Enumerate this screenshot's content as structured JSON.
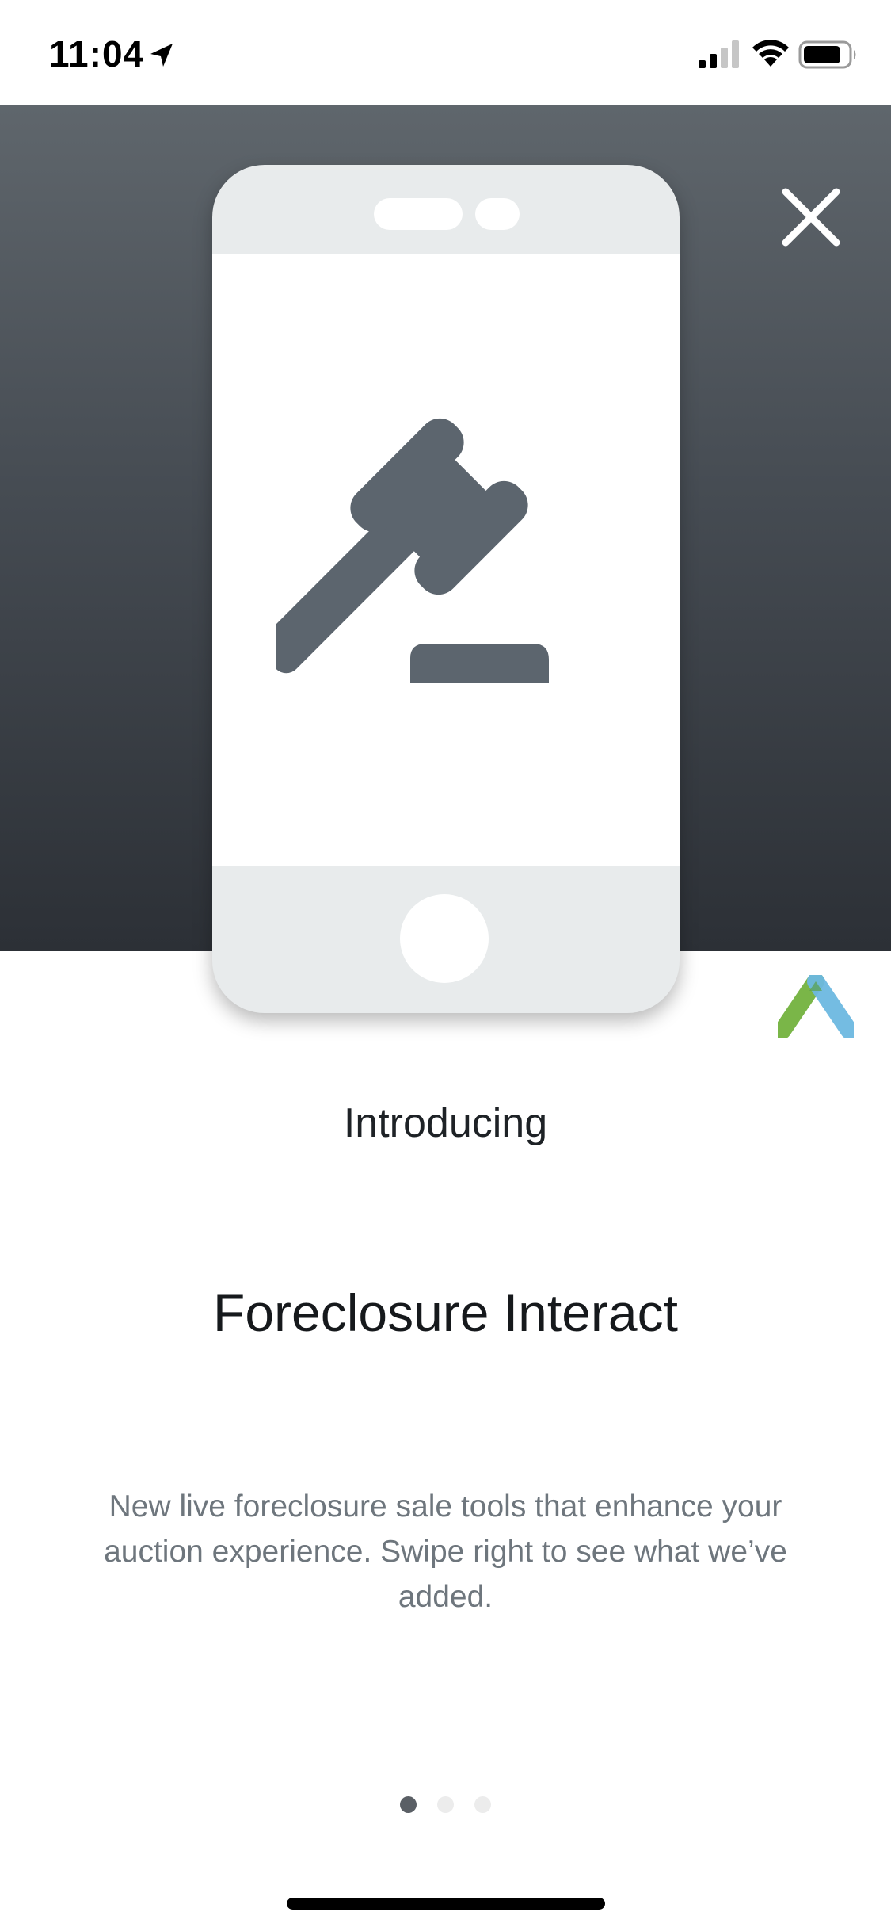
{
  "status_bar": {
    "time": "11:04",
    "icons": [
      "location-arrow-icon",
      "cellular-signal-icon",
      "wifi-icon",
      "battery-icon"
    ]
  },
  "hero": {
    "background_colors": [
      "#5f666c",
      "#2c3036"
    ],
    "illustration": "gavel-icon",
    "close_icon": "close-icon"
  },
  "brand": {
    "logo": "brand-logo-icon",
    "colors": [
      "#7ab648",
      "#6db8e0"
    ]
  },
  "content": {
    "intro": "Introducing",
    "title": "Foreclosure Interact",
    "description": "New live foreclosure sale tools that enhance your auction experience. Swipe right to see what we’ve added."
  },
  "pagination": {
    "total_pages": 3,
    "current_page": 1
  },
  "colors": {
    "icon_gray": "#5c656e",
    "accent_dot": "#5a5f65",
    "inactive_dot": "#ececec"
  }
}
